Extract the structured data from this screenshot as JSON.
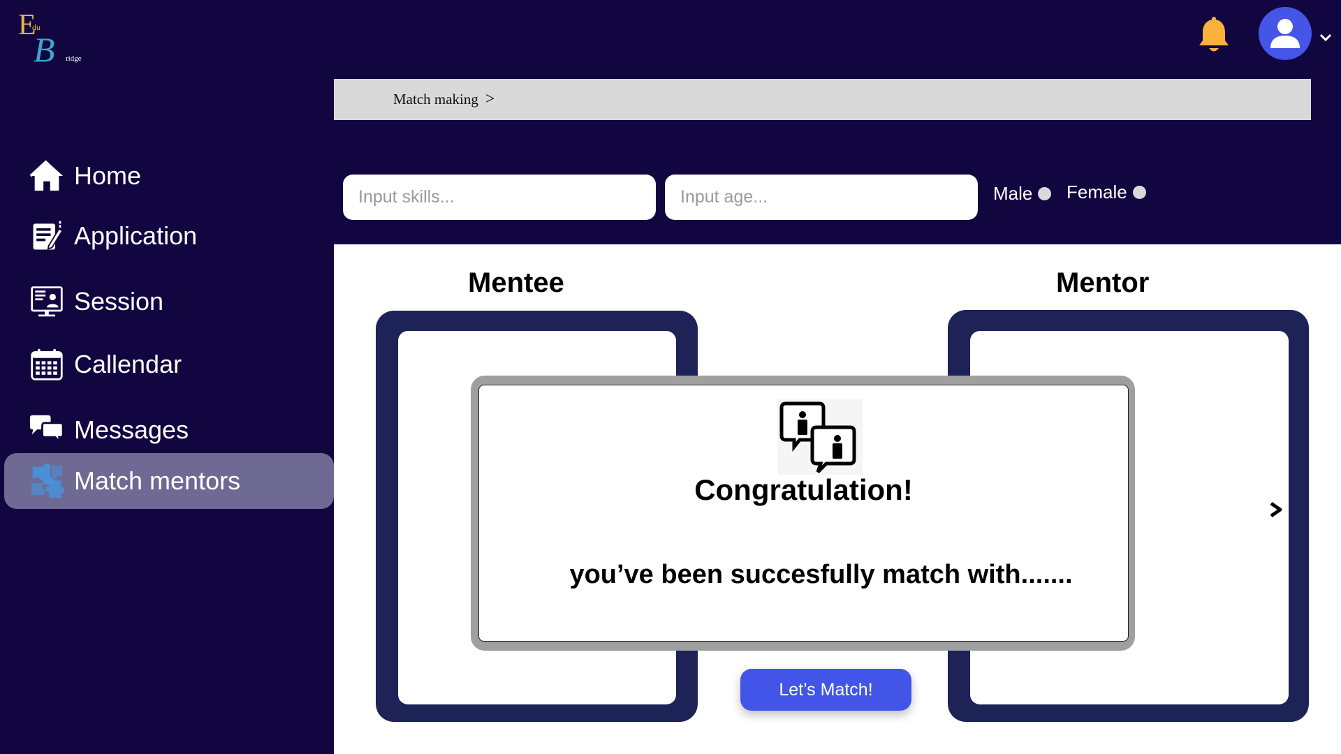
{
  "logo": {
    "letter_e": "E",
    "du": "du",
    "letter_b": "B",
    "ridge": "ridge"
  },
  "sidebar": {
    "items": [
      {
        "label": "Home",
        "icon": "home-icon"
      },
      {
        "label": "Application",
        "icon": "application-icon"
      },
      {
        "label": "Session",
        "icon": "session-icon"
      },
      {
        "label": "Callendar",
        "icon": "calendar-icon"
      },
      {
        "label": "Messages",
        "icon": "messages-icon"
      },
      {
        "label": "Match mentors",
        "icon": "puzzle-icon",
        "active": true
      }
    ]
  },
  "breadcrumb": {
    "label": "Match making",
    "separator": ">"
  },
  "filters": {
    "skills_placeholder": "Input skills...",
    "age_placeholder": "Input age...",
    "male_label": "Male",
    "female_label": "Female"
  },
  "columns": {
    "mentee_title": "Mentee",
    "mentor_title": "Mentor"
  },
  "modal": {
    "title": "Congratulation!",
    "message": "you’ve been succesfully match with......."
  },
  "match_button": "Let’s Match!",
  "colors": {
    "background": "#120640",
    "accent": "#4355e8",
    "card_frame": "#1d2257",
    "active_nav": "#6f6a94",
    "bell": "#fbb13c"
  }
}
